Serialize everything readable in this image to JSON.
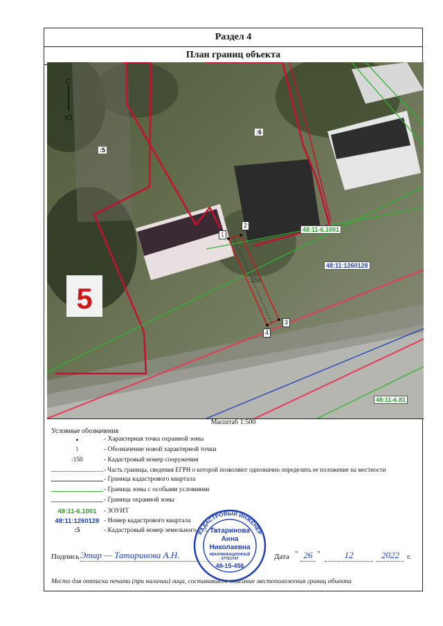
{
  "section_title": "Раздел 4",
  "plan_title": "План границ объекта",
  "compass": {
    "north": "С",
    "south": "Ю"
  },
  "map": {
    "parcel_labels": [
      ":5",
      ":6"
    ],
    "points": [
      "1",
      "2",
      "3",
      "4"
    ],
    "structure_label": ":150",
    "zone_labels": [
      {
        "text": "48:11-6.1001",
        "color": "#2a9b2a"
      },
      {
        "text": "48:11:1260128",
        "color": "#1c3fb8"
      },
      {
        "text": "48:11-6.81",
        "color": "#2a9b2a"
      }
    ],
    "house_number": "5"
  },
  "scale": "Масштаб 1:500",
  "legend": {
    "title": "Условные обозначения",
    "rows": [
      {
        "symbol": "•",
        "text": "- Характерная точка охранной зоны"
      },
      {
        "symbol": "1",
        "text": "- Обозначение новой характерной точки"
      },
      {
        "symbol": ":150",
        "text": "- Кадастровый номер сооружения"
      },
      {
        "symbol": "",
        "text": "- Часть границы, сведения ЕГРН о которой позволяют однозначно определить ее положение на местности"
      },
      {
        "symbol": "",
        "text": "- Граница кадастрового квартала"
      },
      {
        "symbol": "",
        "text": "- Граница зоны с особыми условиями"
      },
      {
        "symbol": "",
        "text": "- Граница охранной зоны"
      },
      {
        "symbol": "48:11-6.1001",
        "text": "- ЗОУИТ"
      },
      {
        "symbol": "48:11:1260128",
        "text": "- Номер кадастрового квартала"
      },
      {
        "symbol": ":5",
        "text": "- Кадастровый номер земельного участка"
      }
    ]
  },
  "colors": {
    "quarter": "#1c3fb8",
    "zone": "#2a9b2a",
    "protect": "#e0304a",
    "point_red": "#d01818"
  },
  "signature": {
    "label": "Подпись",
    "handwritten": "Этар — Татаринова А.Н.",
    "date_label": "Дата",
    "day": "26",
    "month": "12",
    "year": "2022",
    "year_suffix": "г."
  },
  "stamp": {
    "ring_text": "КАДАСТРОВЫЙ ИНЖЕНЕР",
    "name_line1": "Татаринова",
    "name_line2": "Анна",
    "name_line3": "Николаевна",
    "cert": "КВАЛИФИКАЦИОННЫЙ АТТЕСТАТ",
    "cert_no": "48-15-456"
  },
  "note": "Место для оттиска печати (при наличии) лица, составившего описание местоположения границ объекта"
}
